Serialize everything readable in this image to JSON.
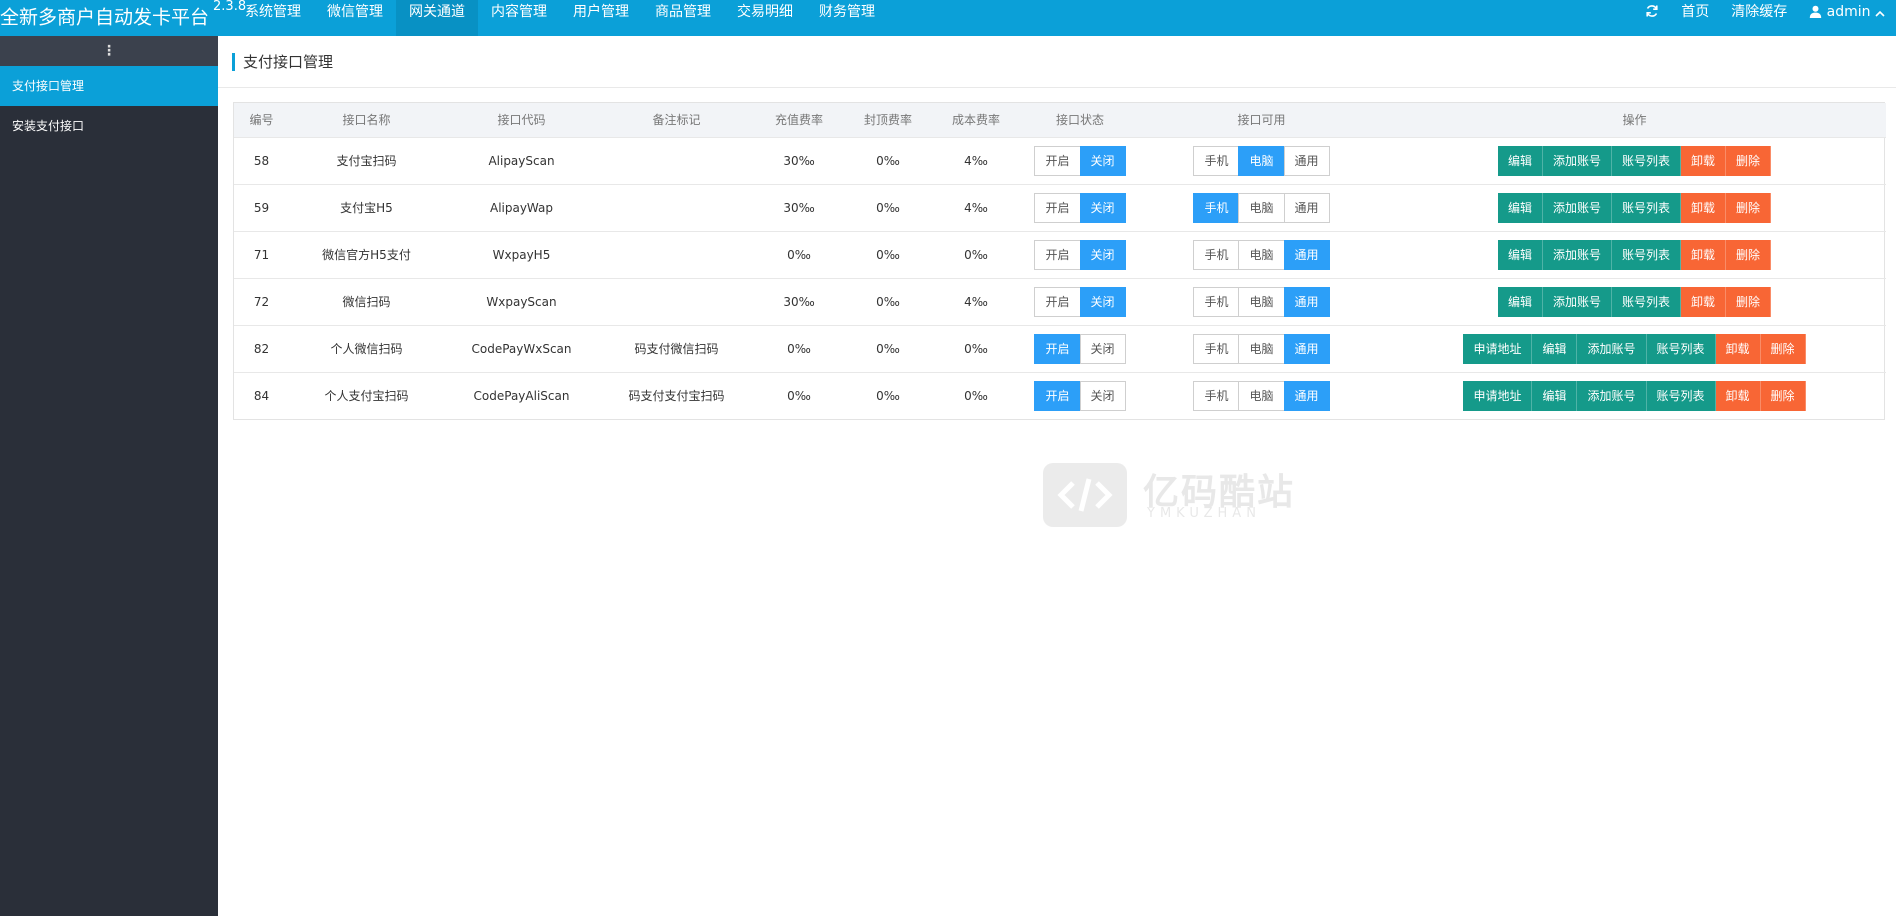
{
  "app": {
    "title": "全新多商户自动发卡平台",
    "version": "2.3.8"
  },
  "nav": [
    {
      "label": "系统管理"
    },
    {
      "label": "微信管理"
    },
    {
      "label": "网关通道",
      "active": true
    },
    {
      "label": "内容管理"
    },
    {
      "label": "用户管理"
    },
    {
      "label": "商品管理"
    },
    {
      "label": "交易明细"
    },
    {
      "label": "财务管理"
    }
  ],
  "topright": {
    "refresh_icon": "refresh-icon",
    "home": "首页",
    "clear_cache": "清除缓存",
    "user": "admin",
    "user_icon": "user-icon"
  },
  "sidebar": {
    "toggle": "⋮",
    "items": [
      {
        "label": "支付接口管理",
        "active": true
      },
      {
        "label": "安装支付接口"
      }
    ]
  },
  "page": {
    "title": "支付接口管理"
  },
  "table": {
    "headers": [
      "编号",
      "接口名称",
      "接口代码",
      "备注标记",
      "充值费率",
      "封顶费率",
      "成本费率",
      "接口状态",
      "接口可用",
      "操作"
    ],
    "rows": [
      {
        "id": "58",
        "name": "支付宝扫码",
        "code": "AlipayScan",
        "remark": "",
        "rate": "30‰",
        "cap": "0‰",
        "cost": "4‰",
        "status": "off",
        "avail": "pc",
        "has_apply": false
      },
      {
        "id": "59",
        "name": "支付宝H5",
        "code": "AlipayWap",
        "remark": "",
        "rate": "30‰",
        "cap": "0‰",
        "cost": "4‰",
        "status": "off",
        "avail": "mobile",
        "has_apply": false
      },
      {
        "id": "71",
        "name": "微信官方H5支付",
        "code": "WxpayH5",
        "remark": "",
        "rate": "0‰",
        "cap": "0‰",
        "cost": "0‰",
        "status": "off",
        "avail": "all",
        "has_apply": false
      },
      {
        "id": "72",
        "name": "微信扫码",
        "code": "WxpayScan",
        "remark": "",
        "rate": "30‰",
        "cap": "0‰",
        "cost": "4‰",
        "status": "off",
        "avail": "all",
        "has_apply": false
      },
      {
        "id": "82",
        "name": "个人微信扫码",
        "code": "CodePayWxScan",
        "remark": "码支付微信扫码",
        "rate": "0‰",
        "cap": "0‰",
        "cost": "0‰",
        "status": "on",
        "avail": "all",
        "has_apply": true
      },
      {
        "id": "84",
        "name": "个人支付宝扫码",
        "code": "CodePayAliScan",
        "remark": "码支付支付宝扫码",
        "rate": "0‰",
        "cap": "0‰",
        "cost": "0‰",
        "status": "on",
        "avail": "all",
        "has_apply": true
      }
    ]
  },
  "labels": {
    "status_on": "开启",
    "status_off": "关闭",
    "avail_mobile": "手机",
    "avail_pc": "电脑",
    "avail_all": "通用",
    "apply": "申请地址",
    "edit": "编辑",
    "add_account": "添加账号",
    "account_list": "账号列表",
    "uninstall": "卸载",
    "delete": "删除"
  },
  "watermark": {
    "text": "亿码酷站",
    "sub": "YMKUZHAN"
  },
  "colors": {
    "primary": "#0ba0d8",
    "toggle_on": "#2c9ff8",
    "green": "#159a8a",
    "orange": "#f86635",
    "sidebar": "#2a2f39"
  }
}
